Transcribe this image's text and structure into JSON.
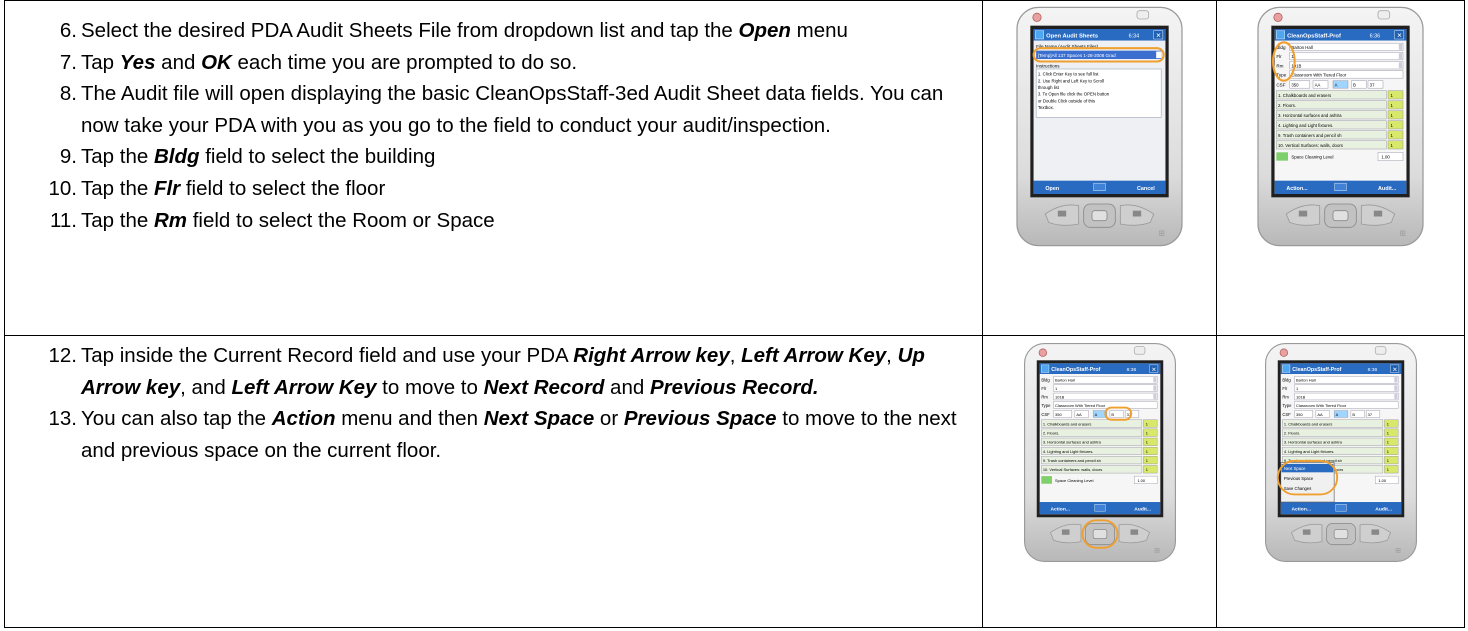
{
  "steps_row1": [
    {
      "num": "6.",
      "parts": [
        "Select the desired PDA Audit Sheets File from dropdown list and tap the ",
        "Open",
        " menu"
      ]
    },
    {
      "num": "7.",
      "parts": [
        "Tap ",
        "Yes",
        " and ",
        "OK",
        " each time you are prompted to do so."
      ]
    },
    {
      "num": "8.",
      "parts": [
        "The Audit file will open displaying the basic CleanOpsStaff-3ed Audit Sheet data fields. You can now take your PDA with you as you go to the field to conduct your audit/inspection."
      ]
    },
    {
      "num": "9.",
      "parts": [
        "Tap the ",
        "Bldg",
        " field to select the building"
      ]
    },
    {
      "num": "10.",
      "parts": [
        "Tap the ",
        "Flr",
        " field to select the floor"
      ]
    },
    {
      "num": "11.",
      "parts": [
        "Tap the ",
        "Rm",
        " field to select the Room or Space"
      ]
    }
  ],
  "steps_row2": [
    {
      "num": "12.",
      "parts": [
        "Tap inside the Current Record field and use your PDA ",
        "Right Arrow key",
        ", ",
        "Left Arrow Key",
        ", ",
        "Up Arrow key",
        ", and ",
        "Left Arrow Key",
        " to move to ",
        "Next Record",
        " and ",
        "Previous Record."
      ]
    },
    {
      "num": "13.",
      "parts": [
        "You can also tap the ",
        "Action",
        " menu and then ",
        "Next Space",
        " or ",
        "Previous Space",
        " to move to the next and previous space on the current floor."
      ]
    }
  ],
  "screens": {
    "open_dialog": {
      "title": "Open Audit Sheets",
      "clock": "6:34",
      "file_label": "File Name (Audit Sheets Files)",
      "file_value": "[Temp]All 137 Spaces 1-28-2008 Grad",
      "instructions_label": "Instructions",
      "instructions": [
        "1. Click Enter Key to see full list",
        "2. Use Right and Left Key to Scroll",
        "through list",
        "3. To Open file click the OPEN button",
        "or Double Click outside of this",
        "Textbox."
      ],
      "soft_left": "Open",
      "soft_right": "Cancel"
    },
    "audit_form": {
      "title": "CleanOpsStaff-Prof",
      "clock": "6:36",
      "labels": [
        "Bldg",
        "Flr",
        "Rm",
        "Type",
        "CSF"
      ],
      "bldg": "Barton Hall",
      "flr": "1",
      "rm": "101B",
      "type": "Classroom With Tiered Floor",
      "csf": [
        "350",
        "AA",
        "A",
        "B",
        "37"
      ],
      "items": [
        "1. Chalkboards and erasers",
        "2. Floors.",
        "3. Horizontal surfaces and ashtra",
        "4. Lighting and Light fixtures.",
        "9. Trash containers and pencil sh",
        "10. Vertical Surfaces: walls, doors"
      ],
      "item_scores": [
        "1",
        "1",
        "1",
        "1",
        "1",
        "1"
      ],
      "cleaning_label": "Space Cleaning Level",
      "cleaning_value": "1.00",
      "soft_left": "Action...",
      "soft_right": "Audit..."
    },
    "action_menu": {
      "items": [
        "Next Space",
        "Previous Space",
        "Save Changes"
      ],
      "cleaning_value": "1.00"
    }
  },
  "colors": {
    "device_body": "#dcdcdc",
    "title_bar": "#2a6bc2",
    "highlight_circle": "#f0a030",
    "score_box": "#d8e86a"
  }
}
